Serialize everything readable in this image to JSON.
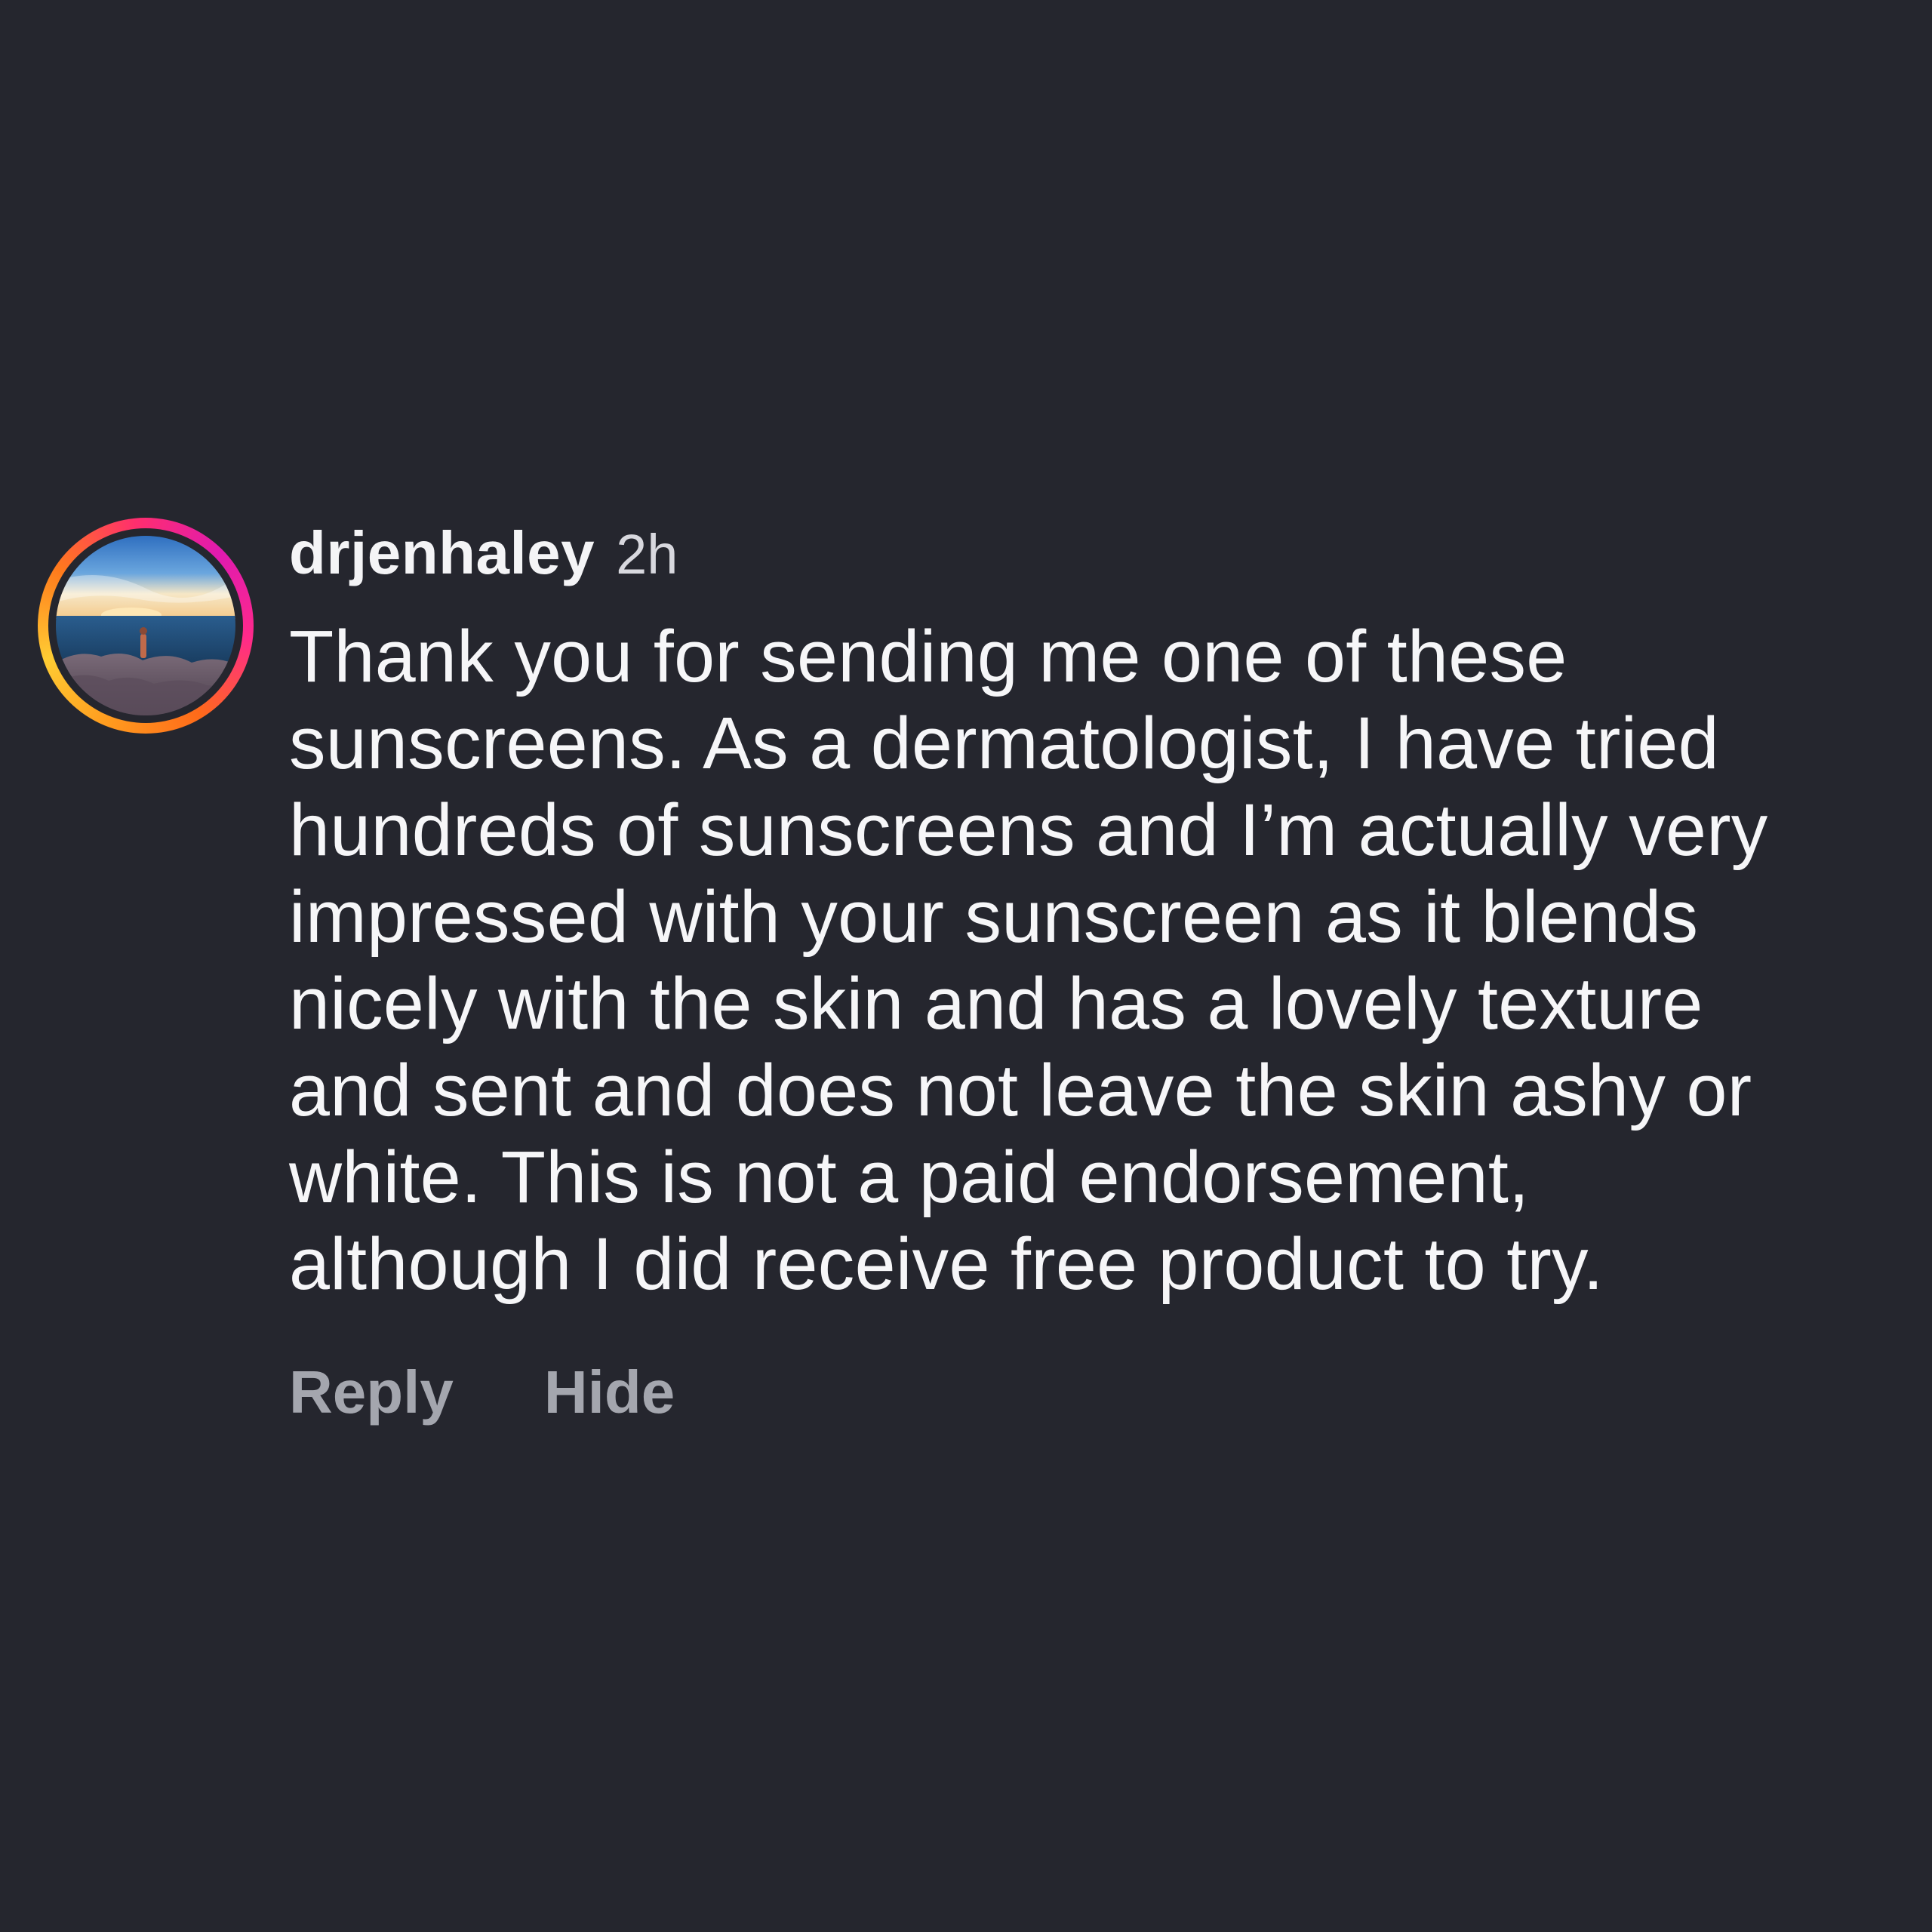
{
  "comment": {
    "username": "drjenhaley",
    "timestamp": "2h",
    "text_lines": [
      "Thank you for sending me one of these",
      "sunscreens. As a dermatologist, I have tried",
      "hundreds of sunscreens and I’m actually very",
      "impressed with your sunscreen as it blends",
      "nicely with the skin and has a lovely texture",
      "and sent and does not leave the skin ashy or",
      "white. This is not a paid endorsement,",
      "although I did receive free product to try."
    ],
    "avatar_icon": "profile-photo-seaside-sunset",
    "story_ring": true
  },
  "actions": {
    "reply_label": "Reply",
    "hide_label": "Hide"
  },
  "colors": {
    "background": "#25262e",
    "text_primary": "#f6f6f8",
    "text_secondary": "#a4a6ae",
    "ring_gradient": [
      "#ffcc33",
      "#ff9a1e",
      "#ff2e6e",
      "#e01ab0"
    ]
  }
}
